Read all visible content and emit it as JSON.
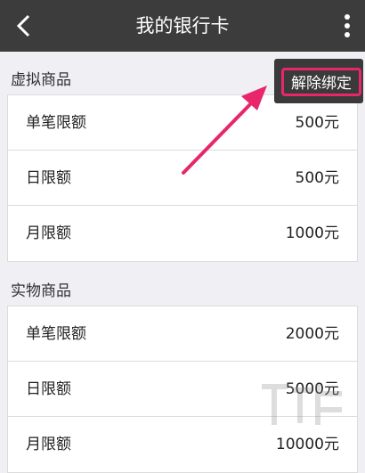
{
  "header": {
    "title": "我的银行卡",
    "back_icon": "chevron-left-icon",
    "more_icon": "vertical-ellipsis-icon"
  },
  "overflow_menu": {
    "unbind_label": "解除绑定",
    "highlight_color": "#e8266b"
  },
  "sections": [
    {
      "title": "虚拟商品",
      "rows": [
        {
          "label": "单笔限额",
          "value": "500元"
        },
        {
          "label": "日限额",
          "value": "500元"
        },
        {
          "label": "月限额",
          "value": "1000元"
        }
      ]
    },
    {
      "title": "实物商品",
      "rows": [
        {
          "label": "单笔限额",
          "value": "2000元"
        },
        {
          "label": "日限额",
          "value": "5000元"
        },
        {
          "label": "月限额",
          "value": "10000元"
        }
      ]
    }
  ],
  "colors": {
    "header_bg": "#3c3c3c",
    "page_bg": "#efeff4",
    "annotation_arrow": "#e8266b"
  }
}
